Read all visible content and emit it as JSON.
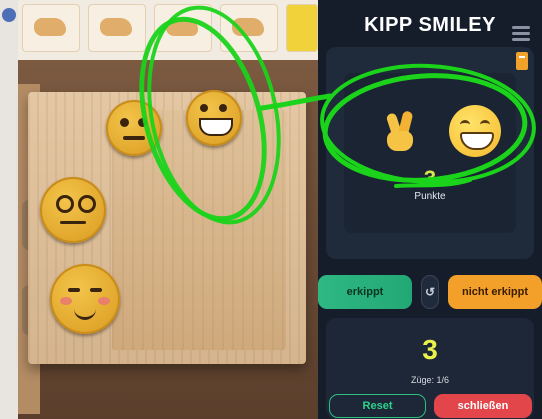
{
  "app": {
    "title": "KIPP SMILEY",
    "menu_icon": "hamburger-menu-icon",
    "corner_tab_icon": "bookmark-icon"
  },
  "display": {
    "emoji_left": "crossed-fingers",
    "emoji_right": "grinning-face",
    "points_value": "3",
    "points_label": "Punkte"
  },
  "actions": {
    "erkippt_label": "erkippt",
    "reload_label": "↺",
    "nicht_erkippt_label": "nicht erkippt"
  },
  "status": {
    "score": "3",
    "moves_label": "Züge: 1/6"
  },
  "footer": {
    "reset_label": "Reset",
    "close_label": "schließen"
  },
  "colors": {
    "background": "#151d2b",
    "accent_green": "#2fb883",
    "accent_orange": "#f2a02a",
    "accent_red": "#e2454a",
    "score_yellow": "#e9f24a",
    "annotation_green": "#1ad31a"
  }
}
